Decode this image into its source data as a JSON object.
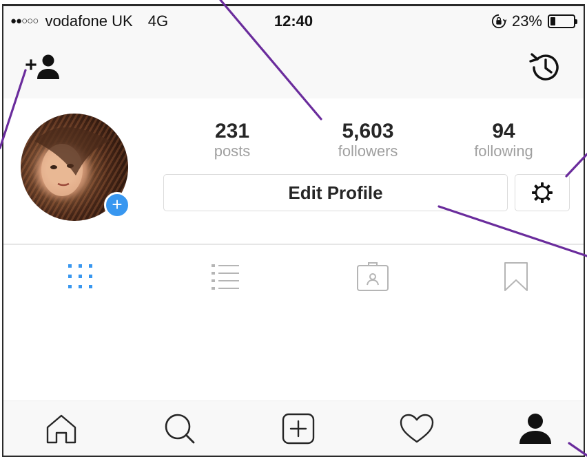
{
  "status_bar": {
    "signal": "●●○○○",
    "carrier": "vodafone UK",
    "network": "4G",
    "time": "12:40",
    "battery": "23%",
    "battery_level": 0.23
  },
  "profile": {
    "stats": [
      {
        "value": "231",
        "label": "posts"
      },
      {
        "value": "5,603",
        "label": "followers"
      },
      {
        "value": "94",
        "label": "following"
      }
    ],
    "edit_button": "Edit Profile",
    "add_story": "+"
  },
  "tabs": [
    {
      "icon": "grid-icon",
      "active": true
    },
    {
      "icon": "list-icon",
      "active": false
    },
    {
      "icon": "tagged-icon",
      "active": false
    },
    {
      "icon": "saved-icon",
      "active": false
    }
  ],
  "bottom_nav": [
    "home-icon",
    "search-icon",
    "new-post-icon",
    "activity-icon",
    "profile-icon"
  ],
  "colors": {
    "accent": "#3897f0",
    "callout": "#6a2c9c",
    "text": "#262626",
    "muted": "#a0a0a0"
  }
}
